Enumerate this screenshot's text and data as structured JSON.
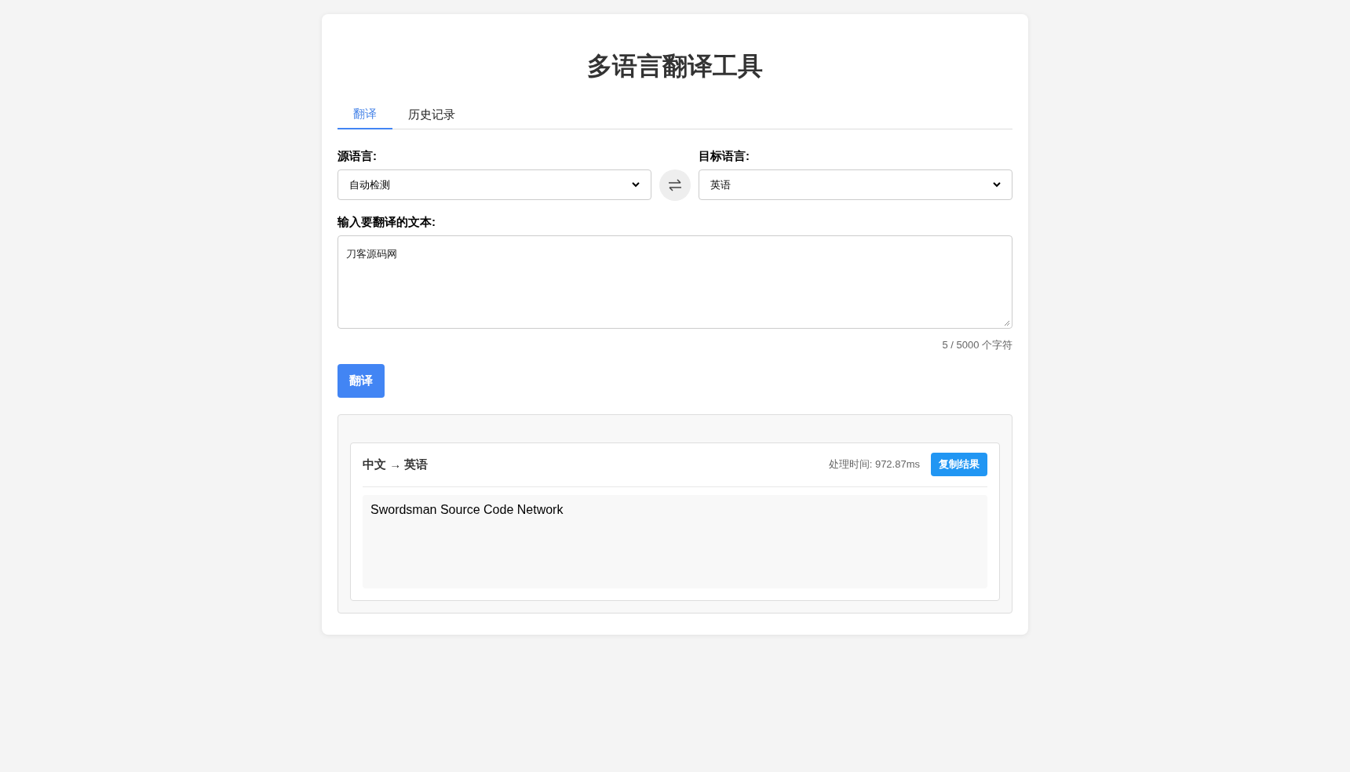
{
  "title": "多语言翻译工具",
  "tabs": [
    {
      "label": "翻译",
      "selected": true
    },
    {
      "label": "历史记录",
      "selected": false
    }
  ],
  "source": {
    "label": "源语言:",
    "value": "自动检测"
  },
  "target": {
    "label": "目标语言:",
    "value": "英语"
  },
  "input": {
    "label": "输入要翻译的文本:",
    "value": "刀客源码网",
    "counter": "5 / 5000 个字符"
  },
  "translate_button": "翻译",
  "result": {
    "direction": "中文 → 英语",
    "time": "处理时间: 972.87ms",
    "copy_button": "复制结果",
    "text": "Swordsman Source Code Network"
  }
}
